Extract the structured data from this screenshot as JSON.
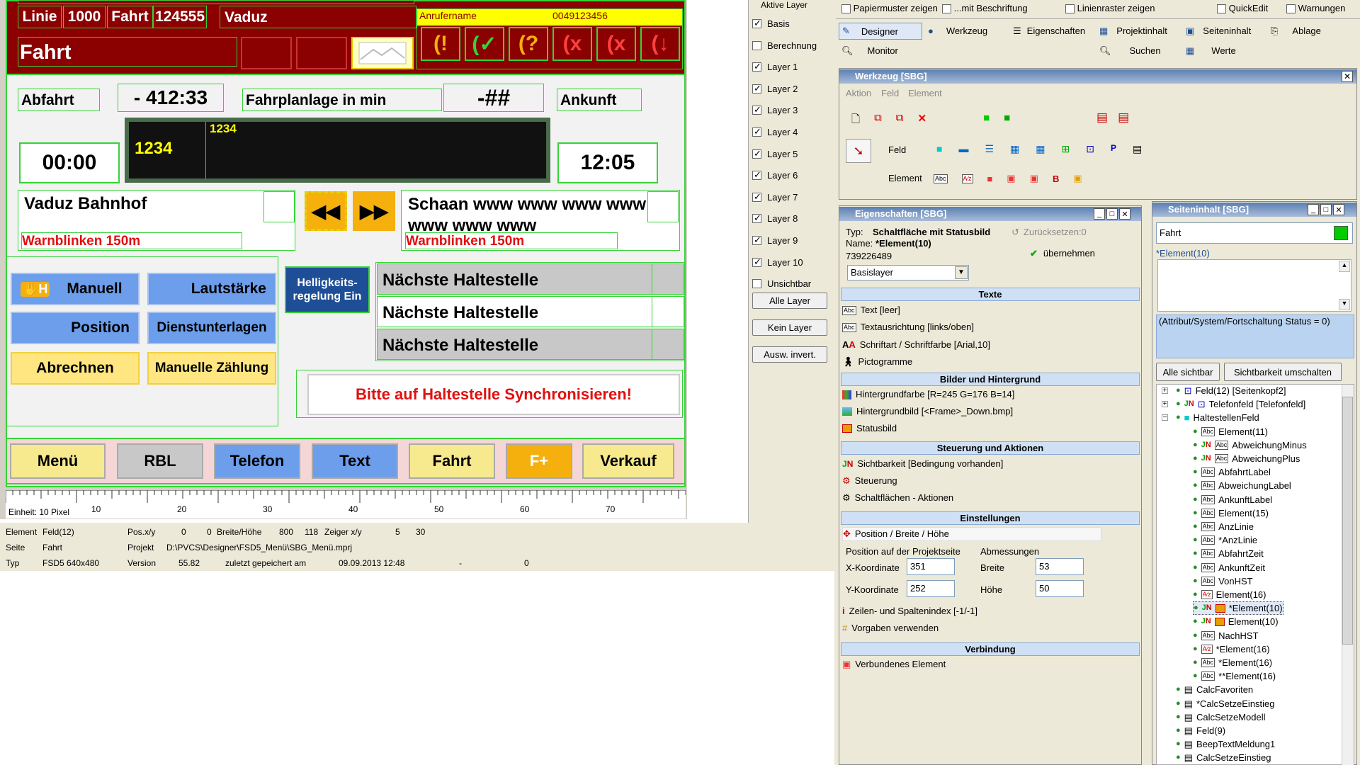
{
  "display": {
    "linie_label": "Linie",
    "linie": "1000",
    "fahrt_label": "Fahrt",
    "fahrt": "124555",
    "ort": "Vaduz",
    "anrufername": "Anrufername",
    "telefon": "0049123456",
    "page_title": "Fahrt",
    "abfahrt": "Abfahrt",
    "abweichung": "- 412:33",
    "fahrplanlage": "Fahrplanlage in min",
    "hash": "-##",
    "ankunft": "Ankunft",
    "abfahrt_zeit": "00:00",
    "ankunft_zeit": "12:05",
    "lcd_big": "1234",
    "lcd_small": "1234",
    "von_hst": "Vaduz Bahnhof",
    "nach_hst": "Schaan www www www www www www www",
    "warn1": "Warnblinken 150m",
    "warn2": "Warnblinken 150m",
    "btn_manuell": "Manuell",
    "btn_lautstaerke": "Lautstärke",
    "btn_helligkeit": "Helligkeits-regelung Ein",
    "btn_position": "Position",
    "btn_dienst": "Dienstunterlagen",
    "btn_abrechnen": "Abrechnen",
    "btn_zaehlung": "Manuelle Zählung",
    "next_stops": [
      "Nächste Haltestelle",
      "Nächste Haltestelle",
      "Nächste Haltestelle"
    ],
    "sync_msg": "Bitte auf Haltestelle Synchronisieren!",
    "bottom": [
      "Menü",
      "RBL",
      "Telefon",
      "Text",
      "Fahrt",
      "F+",
      "Verkauf"
    ],
    "ruler_unit": "Einheit: 10 Pixel",
    "ruler_ticks": [
      "10",
      "20",
      "30",
      "40",
      "50",
      "60",
      "70"
    ]
  },
  "status": {
    "element_label": "Element",
    "element": "Feld(12)",
    "pos_label": "Pos.x/y",
    "pos_x": "0",
    "pos_y": "0",
    "bh_label": "Breite/Höhe",
    "breite": "800",
    "hoehe": "118",
    "zeiger_label": "Zeiger x/y",
    "zeiger_x": "5",
    "zeiger_y": "30",
    "seite_label": "Seite",
    "seite": "Fahrt",
    "projekt_label": "Projekt",
    "projekt": "D:\\PVCS\\Designer\\FSD5_Menü\\SBG_Menü.mprj",
    "typ_label": "Typ",
    "typ": "FSD5 640x480",
    "version_label": "Version",
    "version": "55.82",
    "saved_label": "zuletzt gepeichert am",
    "saved": "09.09.2013 12:48",
    "dash": "-",
    "zero": "0"
  },
  "layers": {
    "title": "Aktive Layer",
    "items": [
      "Basis",
      "Berechnung",
      "Layer 1",
      "Layer 2",
      "Layer 3",
      "Layer 4",
      "Layer 5",
      "Layer 6",
      "Layer 7",
      "Layer 8",
      "Layer 9",
      "Layer 10",
      "Unsichtbar"
    ],
    "checked": [
      true,
      false,
      true,
      true,
      true,
      true,
      true,
      true,
      true,
      true,
      true,
      true,
      false
    ],
    "btn_all": "Alle Layer",
    "btn_none": "Kein Layer",
    "btn_invert": "Ausw. invert."
  },
  "toolbar": {
    "papier": "Papiermuster zeigen",
    "beschriftung": "...mit Beschriftung",
    "raster": "Linienraster zeigen",
    "quickedit": "QuickEdit",
    "warnungen": "Warnungen",
    "designer": "Designer",
    "werkzeug": "Werkzeug",
    "eigenschaften": "Eigenschaften",
    "projektinhalt": "Projektinhalt",
    "seiteninhalt": "Seiteninhalt",
    "ablage": "Ablage",
    "monitor": "Monitor",
    "suchen": "Suchen",
    "werte": "Werte"
  },
  "werkzeug": {
    "title": "Werkzeug [SBG]",
    "menu": [
      "Aktion",
      "Feld",
      "Element"
    ],
    "feld": "Feld",
    "element": "Element"
  },
  "eigenschaften": {
    "title": "Eigenschaften [SBG]",
    "typ_label": "Typ:",
    "typ": "Schaltfläche mit Statusbild",
    "name_label": "Name:",
    "name": "*Element(10)",
    "id": "739226489",
    "reset": "Zurücksetzen:0",
    "apply": "übernehmen",
    "layer_select": "Basislayer",
    "sec_texte": "Texte",
    "text": "Text [leer]",
    "ausrichtung": "Textausrichtung [links/oben]",
    "schrift": "Schriftart / Schriftfarbe [Arial,10]",
    "pikto": "Pictogramme",
    "sec_bilder": "Bilder und Hintergrund",
    "hgfarbe": "Hintergrundfarbe [R=245 G=176 B=14]",
    "hgbild": "Hintergrundbild [<Frame>_Down.bmp]",
    "statusbild": "Statusbild",
    "sec_steuerung": "Steuerung und Aktionen",
    "sichtbarkeit": "Sichtbarkeit [Bedingung vorhanden]",
    "steuerung": "Steuerung",
    "aktionen": "Schaltflächen - Aktionen",
    "sec_einstellungen": "Einstellungen",
    "posbh": "Position / Breite / Höhe",
    "pos_hdr": "Position auf der Projektseite",
    "abm_hdr": "Abmessungen",
    "x_label": "X-Koordinate",
    "x": "351",
    "y_label": "Y-Koordinate",
    "y": "252",
    "b_label": "Breite",
    "b": "53",
    "h_label": "Höhe",
    "h": "50",
    "index": "Zeilen- und Spaltenindex [-1/-1]",
    "vorgaben": "Vorgaben verwenden",
    "sec_verbindung": "Verbindung",
    "verbunden": "Verbundenes Element"
  },
  "seiteninhalt": {
    "title": "Seiteninhalt [SBG]",
    "page": "Fahrt",
    "selected": "*Element(10)",
    "condition": "(Attribut/System/Fortschaltung Status = 0)",
    "btn_all": "Alle sichtbar",
    "btn_toggle": "Sichtbarkeit umschalten",
    "tree": [
      "Feld(12) [Seitenkopf2]",
      "Telefonfeld [Telefonfeld]",
      "HaltestellenFeld",
      "Element(11)",
      "AbweichungMinus",
      "AbweichungPlus",
      "AbfahrtLabel",
      "AbweichungLabel",
      "AnkunftLabel",
      "Element(15)",
      "AnzLinie",
      "*AnzLinie",
      "AbfahrtZeit",
      "AnkunftZeit",
      "VonHST",
      "Element(16)",
      "*Element(10)",
      "Element(10)",
      "NachHST",
      "*Element(16)",
      "*Element(16)",
      "**Element(16)",
      "CalcFavoriten",
      "*CalcSetzeEinstieg",
      "CalcSetzeModell",
      "Feld(9)",
      "BeepTextMeldung1",
      "CalcSetzeEinstieg"
    ]
  },
  "colors": {
    "header_red": "#8b0000",
    "field_green": "#37d337",
    "btn_blue": "#6d9eeb",
    "btn_yellow": "#ffe680",
    "btn_orange": "#f5b00e"
  }
}
